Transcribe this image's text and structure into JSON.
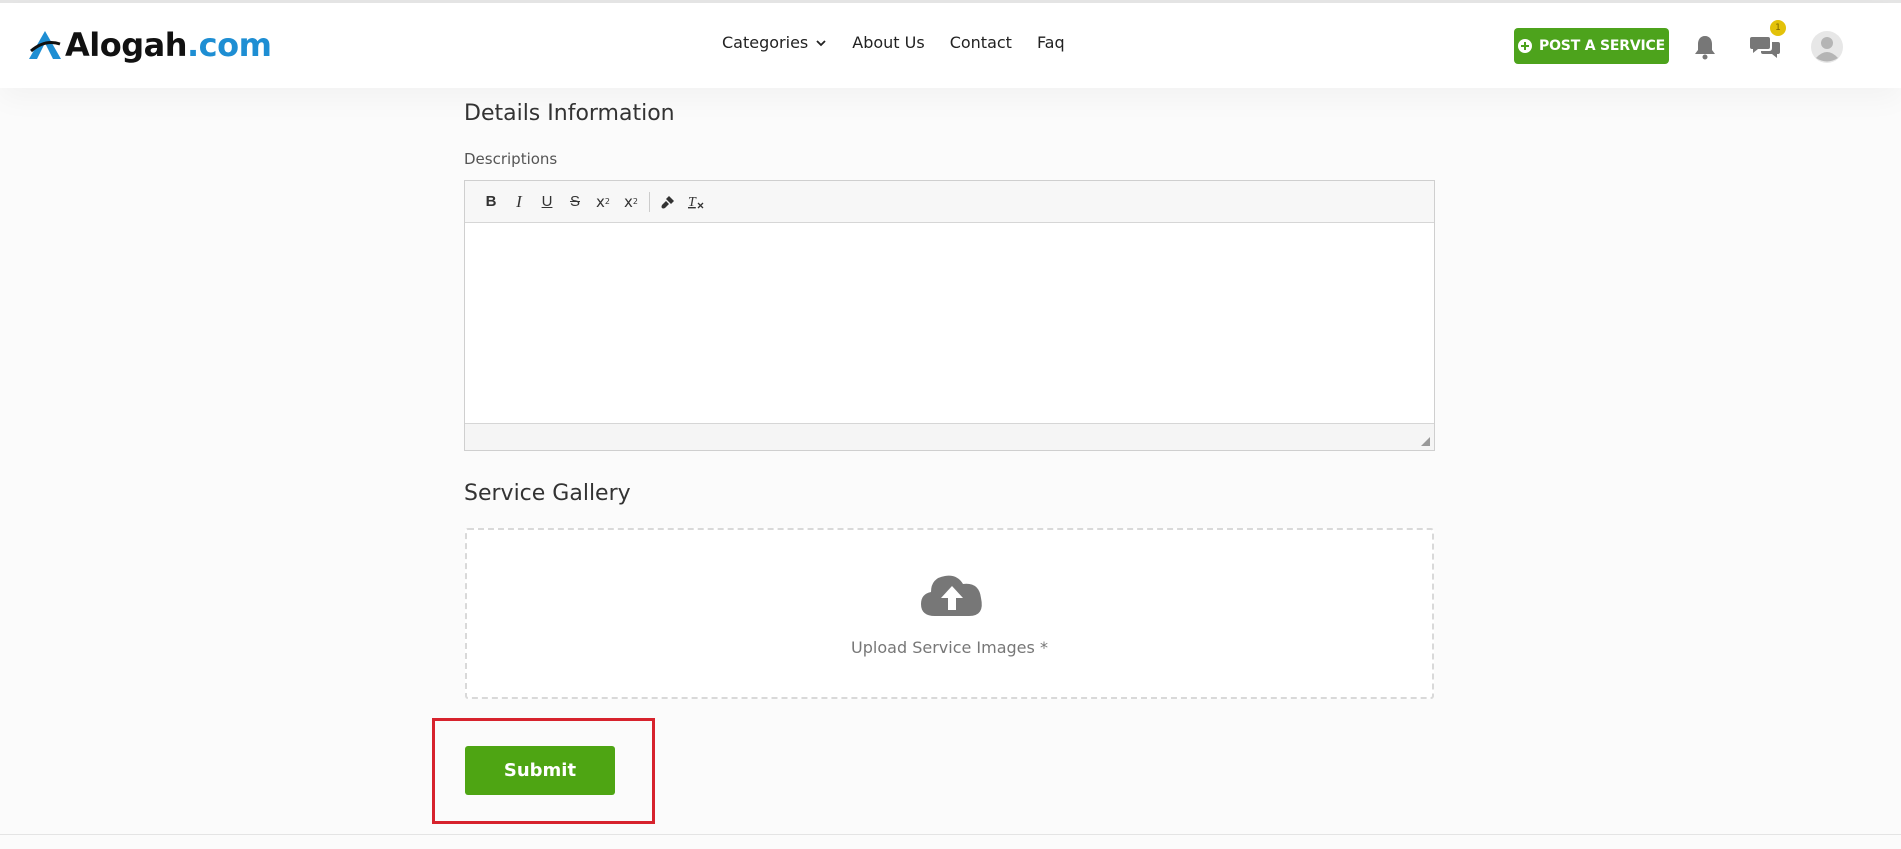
{
  "brand": {
    "name": "Alogah",
    "tld": ".com"
  },
  "nav": {
    "items": [
      "Categories",
      "About Us",
      "Contact",
      "Faq"
    ]
  },
  "header": {
    "post_service_label": "POST A SERVICE",
    "messages_badge": "1"
  },
  "details": {
    "title": "Details Information",
    "descriptions_label": "Descriptions",
    "toolbar": {
      "bold": "B",
      "italic": "I",
      "underline": "U",
      "strike": "S",
      "subscript_base": "x",
      "subscript_mark": "2",
      "superscript_base": "x",
      "superscript_mark": "2",
      "clear_format": "T"
    },
    "content": ""
  },
  "gallery": {
    "title": "Service Gallery",
    "upload_text": "Upload Service Images *"
  },
  "form": {
    "submit_label": "Submit"
  },
  "colors": {
    "accent_green": "#4da31c",
    "brand_blue": "#1e8ed3",
    "highlight_red": "#d7232d",
    "badge_yellow": "#e3c20a"
  },
  "icons": [
    "logo-mark-icon",
    "chevron-down-icon",
    "plus-circle-icon",
    "bell-icon",
    "chat-icon",
    "avatar-icon",
    "brush-icon",
    "clear-format-icon",
    "cloud-upload-icon"
  ]
}
